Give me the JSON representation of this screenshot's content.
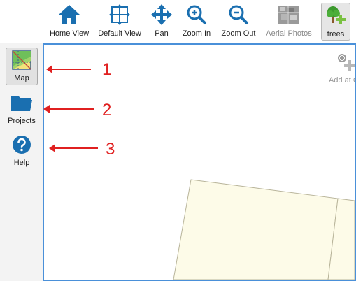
{
  "toolbar": {
    "items": [
      {
        "label": "Home View",
        "icon": "home-icon"
      },
      {
        "label": "Default View",
        "icon": "default-view-icon"
      },
      {
        "label": "Pan",
        "icon": "pan-icon"
      },
      {
        "label": "Zoom In",
        "icon": "zoom-in-icon"
      },
      {
        "label": "Zoom Out",
        "icon": "zoom-out-icon"
      },
      {
        "label": "Aerial Photos",
        "icon": "aerial-photo-icon"
      },
      {
        "label": "trees",
        "icon": "trees-icon"
      }
    ]
  },
  "sidebar": {
    "items": [
      {
        "label": "Map",
        "icon": "map-icon"
      },
      {
        "label": "Projects",
        "icon": "folder-icon"
      },
      {
        "label": "Help",
        "icon": "help-icon"
      }
    ]
  },
  "map": {
    "add_label": "Add at G"
  },
  "annotations": [
    "1",
    "2",
    "3"
  ],
  "colors": {
    "accent": "#1a6fb0",
    "annotation": "#e02020",
    "parcel": "#fdfbe8",
    "frame": "#4a90d9"
  }
}
